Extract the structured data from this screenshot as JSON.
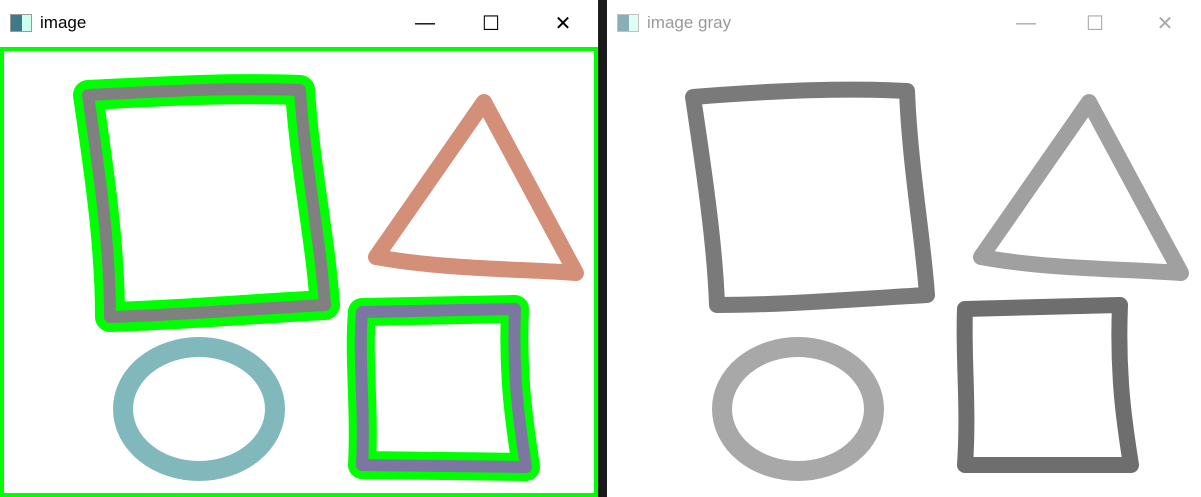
{
  "windows": [
    {
      "title": "image",
      "controls": {
        "minimize": "—",
        "maximize": "☐",
        "close": "✕"
      }
    },
    {
      "title": "image gray",
      "controls": {
        "minimize": "—",
        "maximize": "☐",
        "close": "✕"
      }
    }
  ],
  "colors": {
    "contour": "#00ff00",
    "triangle": "#d38f78",
    "square": "#808080",
    "small_square": "#7b77a0",
    "circle": "#80b8bc"
  }
}
